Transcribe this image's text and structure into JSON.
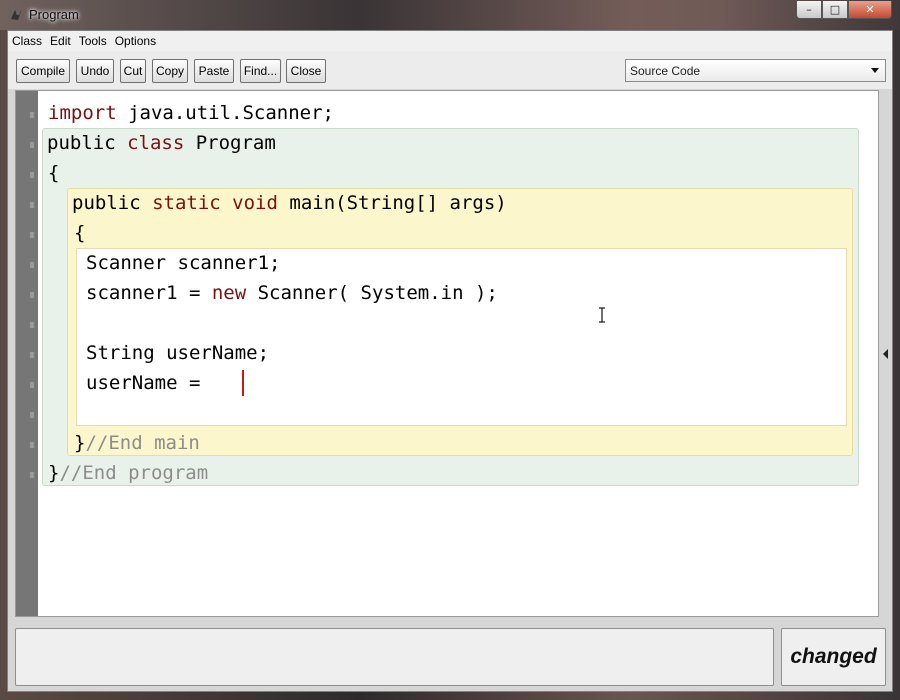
{
  "window": {
    "title": "Program",
    "minimize_glyph": "–",
    "maximize_glyph": "□",
    "close_glyph": "✕"
  },
  "menubar": {
    "items": [
      "Class",
      "Edit",
      "Tools",
      "Options"
    ]
  },
  "toolbar": {
    "compile": "Compile",
    "undo": "Undo",
    "cut": "Cut",
    "copy": "Copy",
    "paste": "Paste",
    "find": "Find...",
    "close": "Close"
  },
  "view_selector": {
    "selected": "Source Code"
  },
  "editor": {
    "lines": {
      "l1_kw": "import",
      "l1_rest": " java.util.Scanner;",
      "l2_a": "public ",
      "l2_kw": "class",
      "l2_b": " Program",
      "l3": "{",
      "l4_a": "public ",
      "l4_kw1": "static",
      "l4_sp": " ",
      "l4_kw2": "void",
      "l4_b": " main(String[] args)",
      "l5": "{",
      "l6": "Scanner scanner1;",
      "l7_a": "scanner1 = ",
      "l7_kw": "new",
      "l7_b": " Scanner( System.in );",
      "l9": "String userName;",
      "l10": "userName = ",
      "l12_a": "}",
      "l12_cm": "//End main",
      "l13_a": "}",
      "l13_cm": "//End program"
    },
    "colors": {
      "keyword": "#7a1010",
      "comment": "#8c8c8c",
      "class_scope": "#e9f2ea",
      "method_scope": "#fbf6cc",
      "caret": "#c21c1c"
    }
  },
  "status": {
    "state": "changed"
  }
}
